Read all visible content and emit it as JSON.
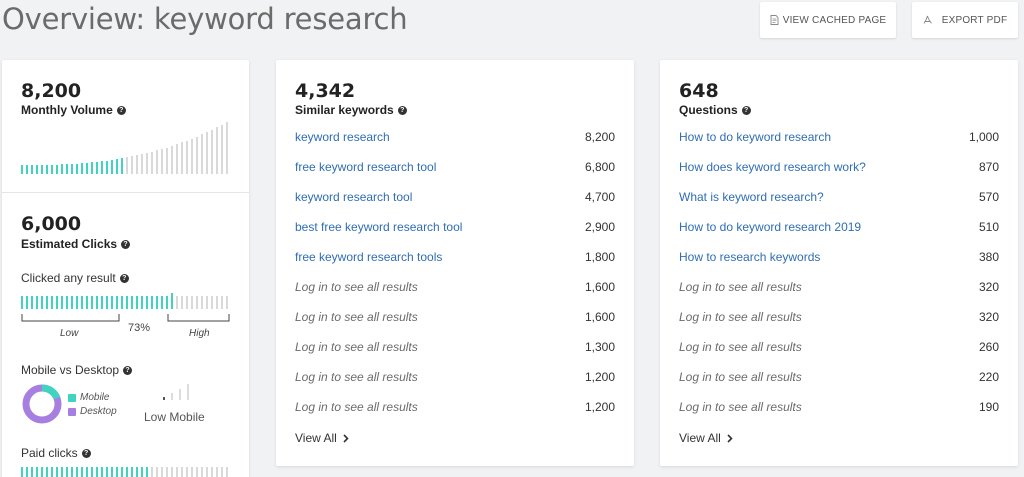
{
  "page": {
    "title": "Overview: keyword research",
    "view_cached_label": "VIEW CACHED PAGE",
    "export_pdf_label": "EXPORT PDF"
  },
  "monthly_volume": {
    "value": "8,200",
    "label": "Monthly Volume"
  },
  "estimated_clicks": {
    "value": "6,000",
    "label": "Estimated Clicks",
    "clicked_any_result_label": "Clicked any result",
    "clicked_percent": "73%",
    "clicked_fraction": 0.73,
    "low_label": "Low",
    "high_label": "High",
    "mobile_vs_desktop_label": "Mobile vs Desktop",
    "mobile_label": "Mobile",
    "desktop_label": "Desktop",
    "device_verdict": "Low Mobile",
    "paid_clicks_label": "Paid clicks"
  },
  "similar_keywords": {
    "count": "4,342",
    "label": "Similar keywords",
    "view_all": "View All",
    "rows": [
      {
        "keyword": "keyword research",
        "volume": "8,200",
        "locked": false
      },
      {
        "keyword": "free keyword research tool",
        "volume": "6,800",
        "locked": false
      },
      {
        "keyword": "keyword research tool",
        "volume": "4,700",
        "locked": false
      },
      {
        "keyword": "best free keyword research tool",
        "volume": "2,900",
        "locked": false
      },
      {
        "keyword": "free keyword research tools",
        "volume": "1,800",
        "locked": false
      },
      {
        "keyword": "Log in to see all results",
        "volume": "1,600",
        "locked": true
      },
      {
        "keyword": "Log in to see all results",
        "volume": "1,600",
        "locked": true
      },
      {
        "keyword": "Log in to see all results",
        "volume": "1,300",
        "locked": true
      },
      {
        "keyword": "Log in to see all results",
        "volume": "1,200",
        "locked": true
      },
      {
        "keyword": "Log in to see all results",
        "volume": "1,200",
        "locked": true
      }
    ]
  },
  "questions": {
    "count": "648",
    "label": "Questions",
    "view_all": "View All",
    "rows": [
      {
        "keyword": "How to do keyword research",
        "volume": "1,000",
        "locked": false
      },
      {
        "keyword": "How does keyword research work?",
        "volume": "870",
        "locked": false
      },
      {
        "keyword": "What is keyword research?",
        "volume": "570",
        "locked": false
      },
      {
        "keyword": "How to do keyword research 2019",
        "volume": "510",
        "locked": false
      },
      {
        "keyword": "How to research keywords",
        "volume": "380",
        "locked": false
      },
      {
        "keyword": "Log in to see all results",
        "volume": "320",
        "locked": true
      },
      {
        "keyword": "Log in to see all results",
        "volume": "320",
        "locked": true
      },
      {
        "keyword": "Log in to see all results",
        "volume": "260",
        "locked": true
      },
      {
        "keyword": "Log in to see all results",
        "volume": "220",
        "locked": true
      },
      {
        "keyword": "Log in to see all results",
        "volume": "190",
        "locked": true
      }
    ]
  },
  "colors": {
    "teal": "#40d3c0",
    "light_gray": "#d9d9d9",
    "link_blue": "#2f6db5",
    "purple": "#a77fe0",
    "page_bg": "#f1f2f3"
  },
  "icons": {
    "view_cached": "document-icon",
    "export_pdf": "pdf-icon",
    "help": "question-mark-icon",
    "chevron": "chevron-right-icon"
  }
}
